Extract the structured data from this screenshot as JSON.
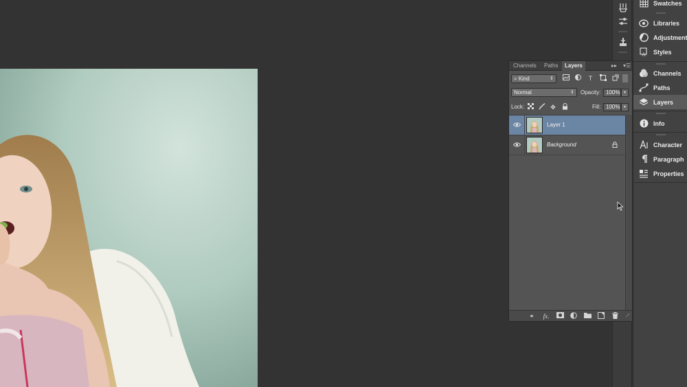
{
  "app": {
    "background_color": "#333333"
  },
  "canvas": {
    "image_description_icon": "photo-girl-angel-wings"
  },
  "tool_strip": {
    "icons": [
      "brush-preset-icon",
      "sliders-icon",
      "clone-source-icon"
    ]
  },
  "dock": {
    "items": [
      {
        "label": "Swatches",
        "icon": "grid-icon"
      },
      {
        "label": "Libraries",
        "icon": "cloud-icon"
      },
      {
        "label": "Adjustments",
        "icon": "half-circle-icon"
      },
      {
        "label": "Styles",
        "icon": "fx-icon"
      },
      {
        "label": "Channels",
        "icon": "rgb-circles-icon"
      },
      {
        "label": "Paths",
        "icon": "pen-path-icon"
      },
      {
        "label": "Layers",
        "icon": "layers-stack-icon",
        "active": true
      },
      {
        "label": "Info",
        "icon": "info-icon"
      },
      {
        "label": "Character",
        "icon": "character-a-icon"
      },
      {
        "label": "Paragraph",
        "icon": "pilcrow-icon"
      },
      {
        "label": "Properties",
        "icon": "properties-icon"
      }
    ]
  },
  "layers_panel": {
    "tabs": [
      {
        "label": "Channels"
      },
      {
        "label": "Paths"
      },
      {
        "label": "Layers",
        "active": true
      }
    ],
    "filter": {
      "label": "Kind"
    },
    "blend_mode": "Normal",
    "opacity": {
      "label": "Opacity:",
      "value": "100%"
    },
    "lock_label": "Lock:",
    "fill": {
      "label": "Fill:",
      "value": "100%"
    },
    "layers": [
      {
        "name": "Layer 1",
        "selected": true,
        "visible": true,
        "locked": false
      },
      {
        "name": "Background",
        "selected": false,
        "visible": true,
        "locked": true,
        "italic": true
      }
    ],
    "accent_selected": "#6b85a4"
  }
}
